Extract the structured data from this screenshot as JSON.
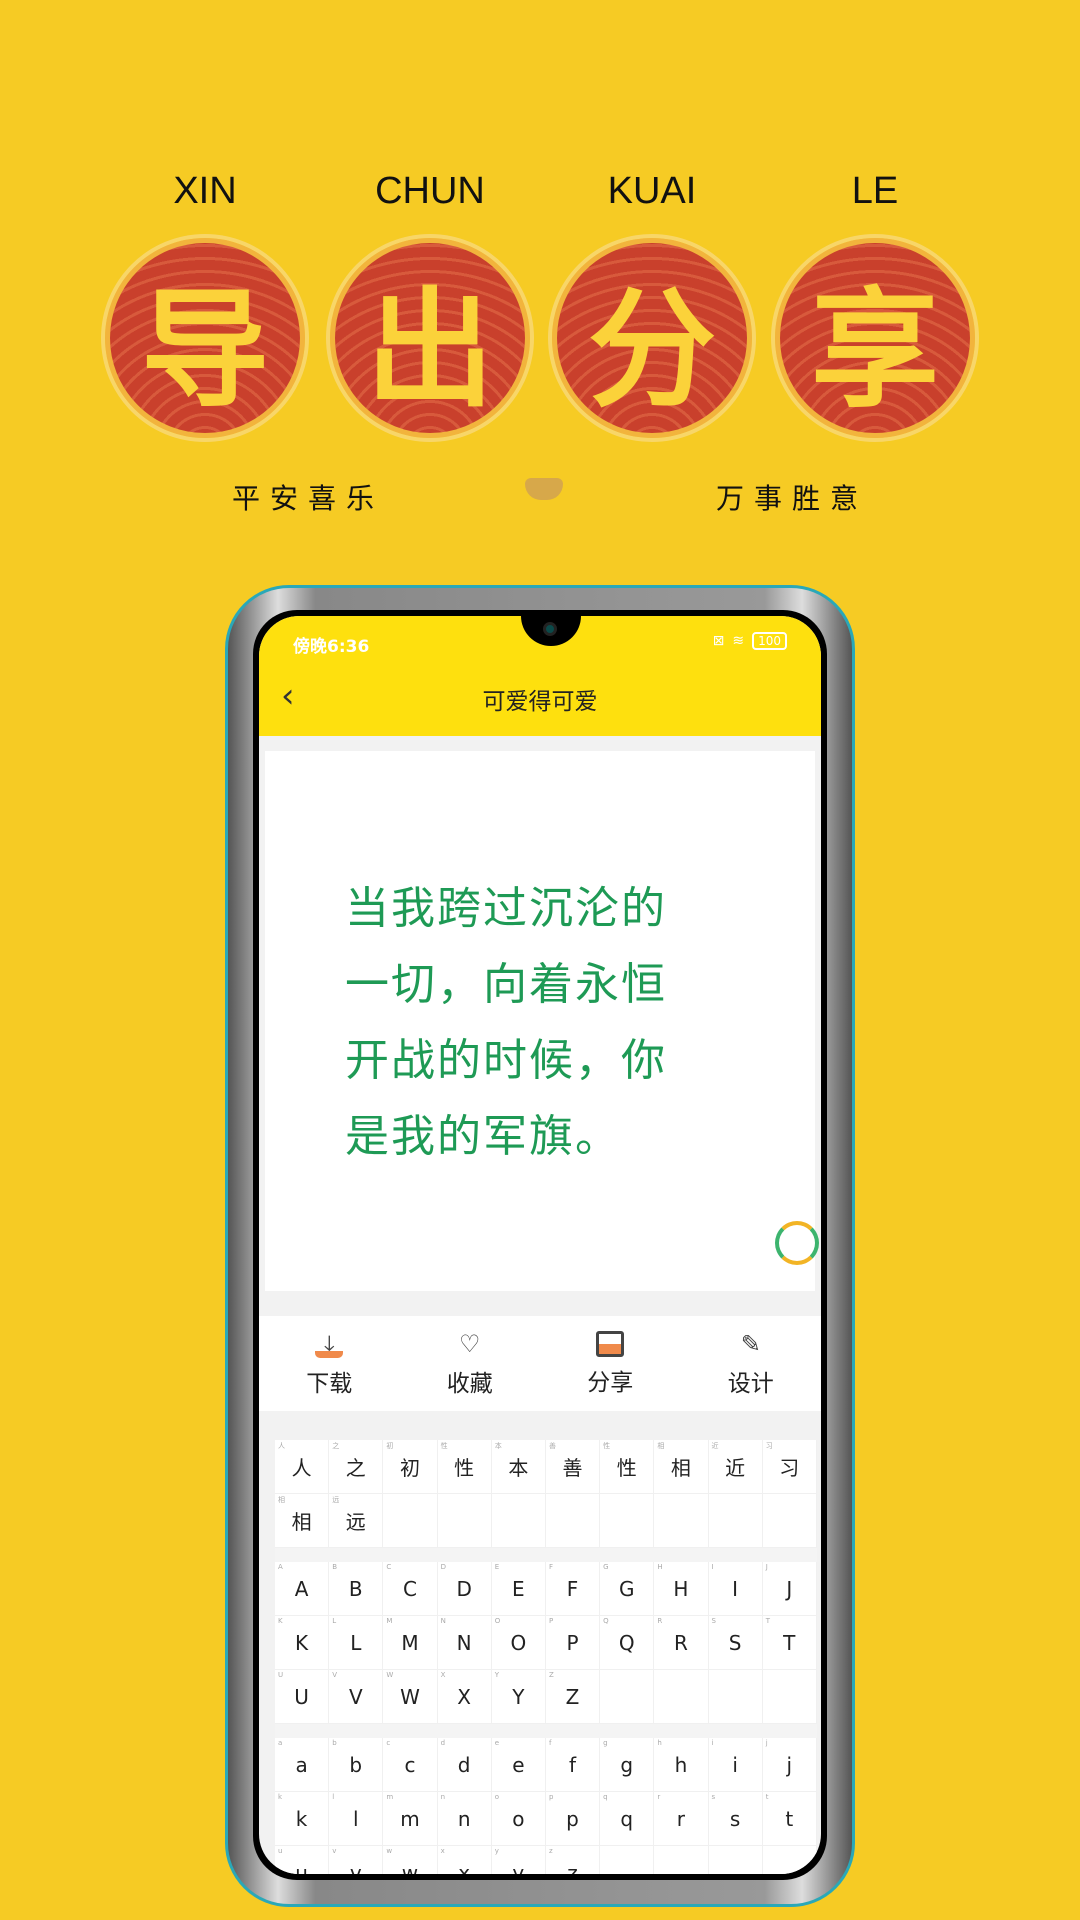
{
  "banner": {
    "pinyin": [
      "XIN",
      "CHUN",
      "KUAI",
      "LE"
    ],
    "characters": [
      "导",
      "出",
      "分",
      "享"
    ],
    "left_phrase": "平安喜乐",
    "right_phrase": "万事胜意"
  },
  "status_bar": {
    "time": "傍晚6:36",
    "battery": "100",
    "icons": [
      "sim-icon",
      "wifi-icon",
      "battery-icon"
    ]
  },
  "header": {
    "title": "可爱得可爱",
    "back_icon": "chevron-left-icon"
  },
  "preview": {
    "lines": [
      "当我跨过沉沦的",
      "一切，向着永恒",
      "开战的时候，你",
      "是我的军旗。"
    ],
    "text_color": "#1e9a55"
  },
  "toolbar": [
    {
      "label": "下载",
      "icon": "download-icon"
    },
    {
      "label": "收藏",
      "icon": "heart-icon"
    },
    {
      "label": "分享",
      "icon": "share-icon"
    },
    {
      "label": "设计",
      "icon": "pencil-icon"
    }
  ],
  "glyph_grid": {
    "chinese": [
      [
        "人",
        "之",
        "初",
        "性",
        "本",
        "善",
        "性",
        "相",
        "近",
        "习"
      ],
      [
        "相",
        "远"
      ]
    ],
    "upper": [
      [
        "A",
        "B",
        "C",
        "D",
        "E",
        "F",
        "G",
        "H",
        "I",
        "J"
      ],
      [
        "K",
        "L",
        "M",
        "N",
        "O",
        "P",
        "Q",
        "R",
        "S",
        "T"
      ],
      [
        "U",
        "V",
        "W",
        "X",
        "Y",
        "Z"
      ]
    ],
    "lower": [
      [
        "a",
        "b",
        "c",
        "d",
        "e",
        "f",
        "g",
        "h",
        "i",
        "j"
      ],
      [
        "k",
        "l",
        "m",
        "n",
        "o",
        "p",
        "q",
        "r",
        "s",
        "t"
      ],
      [
        "u",
        "v",
        "w",
        "x",
        "y",
        "z"
      ]
    ]
  },
  "colors": {
    "background": "#f6cb24",
    "header": "#fee00e",
    "accent": "#f08a4b"
  }
}
